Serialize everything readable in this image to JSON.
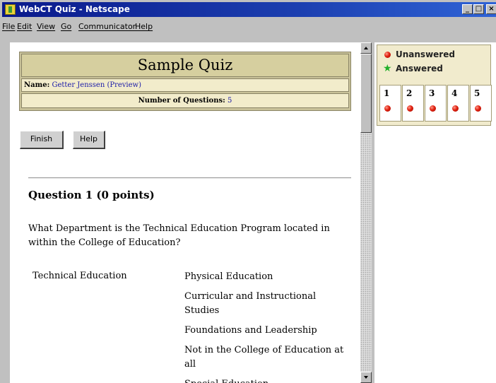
{
  "window": {
    "title": "WebCT Quiz - Netscape",
    "controls": {
      "minimize": "_",
      "maximize": "□",
      "close": "×"
    }
  },
  "menu": {
    "items": [
      "File",
      "Edit",
      "View",
      "Go",
      "Communicator",
      "Help"
    ]
  },
  "quiz": {
    "title": "Sample Quiz",
    "name_label": "Name:",
    "name_value": "Getter Jenssen (Preview)",
    "num_questions_label": "Number of Questions:",
    "num_questions_value": "5"
  },
  "buttons": {
    "finish": "Finish",
    "help": "Help"
  },
  "question": {
    "heading": "Question 1  (0 points)",
    "text": "What Department is the Technical Education Program located in within the College of Education?",
    "match_label": "Technical Education",
    "choices": [
      "Physical Education",
      "Curricular and Instructional Studies",
      "Foundations and Leadership",
      "Not in the College of Education at all",
      "Special Education"
    ]
  },
  "legend": {
    "unanswered": "Unanswered",
    "answered": "Answered",
    "unanswered_color": "#e02010",
    "answered_color": "#21b02a"
  },
  "question_nav": [
    {
      "number": "1",
      "status": "unanswered"
    },
    {
      "number": "2",
      "status": "unanswered"
    },
    {
      "number": "3",
      "status": "unanswered"
    },
    {
      "number": "4",
      "status": "unanswered"
    },
    {
      "number": "5",
      "status": "unanswered"
    }
  ]
}
